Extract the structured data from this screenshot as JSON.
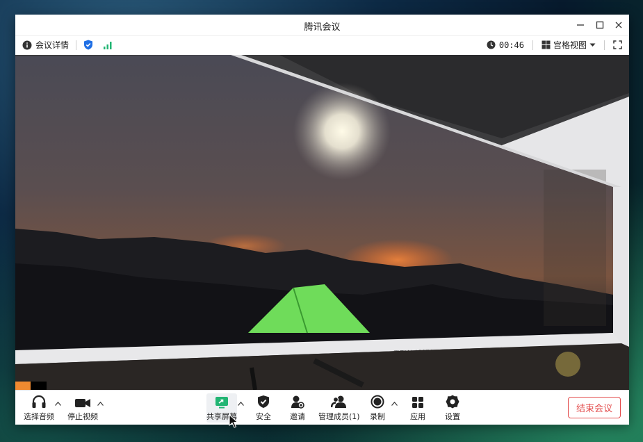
{
  "window": {
    "title": "腾讯会议"
  },
  "infobar": {
    "meeting_details": "会议详情",
    "timer": "00:46",
    "view_mode": "宫格视图"
  },
  "video": {
    "monitor_brand": "TITAN ARMY"
  },
  "toolbar": {
    "audio_label": "选择音频",
    "video_label": "停止视频",
    "share_label": "共享屏幕",
    "security_label": "安全",
    "invite_label": "邀请",
    "members_label": "管理成员(1)",
    "record_label": "录制",
    "apps_label": "应用",
    "settings_label": "设置",
    "end_label": "结束会议"
  },
  "colors": {
    "accent_green": "#22b573",
    "shield_blue": "#1f6fe5",
    "end_red": "#e34d4d"
  }
}
